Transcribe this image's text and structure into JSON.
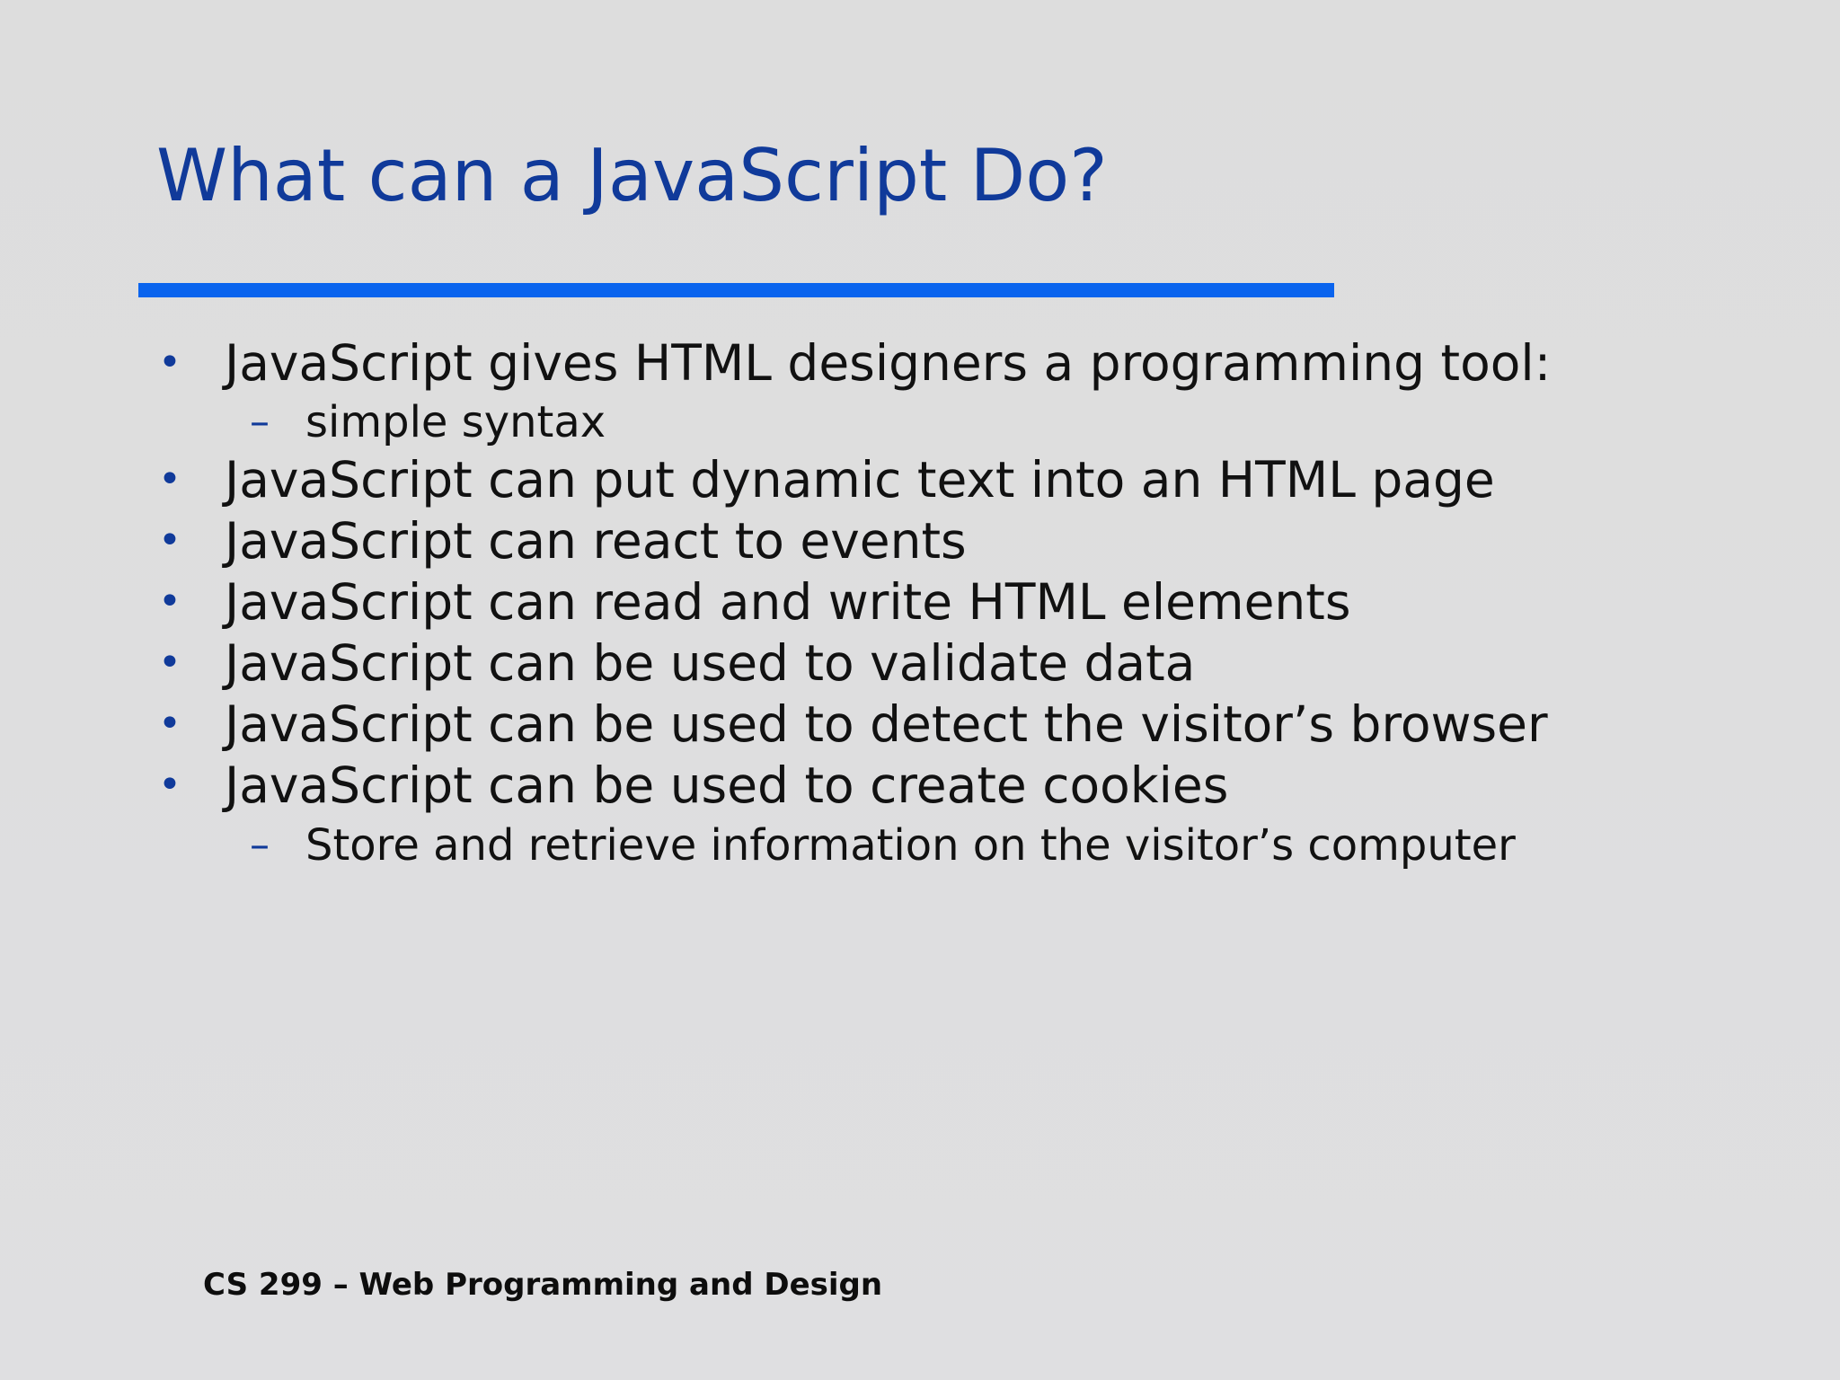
{
  "slide": {
    "title": "What can a JavaScript Do?",
    "bullets": [
      {
        "level": 1,
        "marker": "•",
        "text": "JavaScript gives HTML designers a programming tool:"
      },
      {
        "level": 2,
        "marker": "–",
        "text": "simple syntax"
      },
      {
        "level": 1,
        "marker": "•",
        "text": "JavaScript can put dynamic text into an HTML page"
      },
      {
        "level": 1,
        "marker": "•",
        "text": "JavaScript can react to events"
      },
      {
        "level": 1,
        "marker": "•",
        "text": "JavaScript can read and write HTML elements"
      },
      {
        "level": 1,
        "marker": "•",
        "text": "JavaScript can be used to validate data"
      },
      {
        "level": 1,
        "marker": "•",
        "text": "JavaScript can be used to detect the visitor’s browser"
      },
      {
        "level": 1,
        "marker": "•",
        "text": "JavaScript can be used to create cookies"
      },
      {
        "level": 2,
        "marker": "–",
        "text": "Store and retrieve information on the visitor’s computer"
      }
    ],
    "footer": "CS 299 – Web Programming and Design"
  },
  "colors": {
    "background": "#dedede",
    "title": "#103a9a",
    "rule": "#0a64ee",
    "bullet_marker": "#103a9a",
    "body_text": "#111111"
  }
}
